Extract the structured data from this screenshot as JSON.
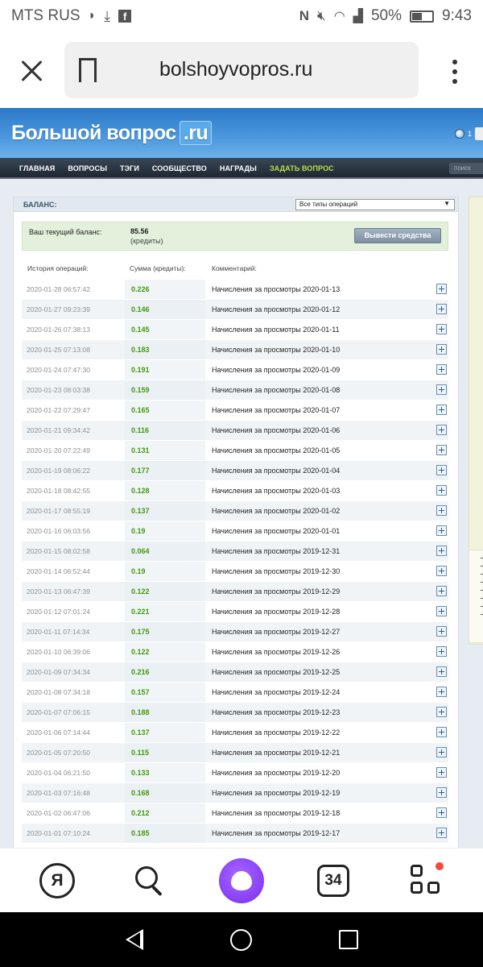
{
  "status_bar": {
    "carrier": "MTS RUS",
    "battery": "50%",
    "time": "9:43"
  },
  "browser": {
    "url": "bolshoyvopros.ru"
  },
  "site": {
    "logo_text": "Большой вопрос",
    "logo_domain": ".ru",
    "header_count": "1",
    "nav": [
      {
        "label": "ГЛАВНАЯ"
      },
      {
        "label": "ВОПРОСЫ"
      },
      {
        "label": "ТЭГИ"
      },
      {
        "label": "СООБЩЕСТВО"
      },
      {
        "label": "НАГРАДЫ"
      },
      {
        "label": "ЗАДАТЬ ВОПРОС"
      }
    ],
    "search_placeholder": "поиск"
  },
  "balance": {
    "section_title": "БАЛАНС:",
    "filter_selected": "Все типы операций",
    "current_label": "Ваш текущий баланс:",
    "amount": "85.56",
    "units": "(кредиты)",
    "withdraw_label": "Вывести средства"
  },
  "history": {
    "col_date": "История операций:",
    "col_sum": "Сумма (кредиты):",
    "col_comment": "Комментарий:",
    "rows": [
      {
        "date": "2020-01-28 06:57:42",
        "sum": "0.226",
        "comment": "Начисления за просмотры 2020-01-13"
      },
      {
        "date": "2020-01-27 09:23:39",
        "sum": "0.146",
        "comment": "Начисления за просмотры 2020-01-12"
      },
      {
        "date": "2020-01-26 07:38:13",
        "sum": "0.145",
        "comment": "Начисления за просмотры 2020-01-11"
      },
      {
        "date": "2020-01-25 07:13:08",
        "sum": "0.183",
        "comment": "Начисления за просмотры 2020-01-10"
      },
      {
        "date": "2020-01-24 07:47:30",
        "sum": "0.191",
        "comment": "Начисления за просмотры 2020-01-09"
      },
      {
        "date": "2020-01-23 08:03:38",
        "sum": "0.159",
        "comment": "Начисления за просмотры 2020-01-08"
      },
      {
        "date": "2020-01-22 07:29:47",
        "sum": "0.165",
        "comment": "Начисления за просмотры 2020-01-07"
      },
      {
        "date": "2020-01-21 09:34:42",
        "sum": "0.116",
        "comment": "Начисления за просмотры 2020-01-06"
      },
      {
        "date": "2020-01-20 07:22:49",
        "sum": "0.131",
        "comment": "Начисления за просмотры 2020-01-05"
      },
      {
        "date": "2020-01-19 08:06:22",
        "sum": "0.177",
        "comment": "Начисления за просмотры 2020-01-04"
      },
      {
        "date": "2020-01-18 08:42:55",
        "sum": "0.128",
        "comment": "Начисления за просмотры 2020-01-03"
      },
      {
        "date": "2020-01-17 08:55:19",
        "sum": "0.137",
        "comment": "Начисления за просмотры 2020-01-02"
      },
      {
        "date": "2020-01-16 06:03:56",
        "sum": "0.19",
        "comment": "Начисления за просмотры 2020-01-01"
      },
      {
        "date": "2020-01-15 08:02:58",
        "sum": "0.064",
        "comment": "Начисления за просмотры 2019-12-31"
      },
      {
        "date": "2020-01-14 06:52:44",
        "sum": "0.19",
        "comment": "Начисления за просмотры 2019-12-30"
      },
      {
        "date": "2020-01-13 06:47:39",
        "sum": "0.122",
        "comment": "Начисления за просмотры 2019-12-29"
      },
      {
        "date": "2020-01-12 07:01:24",
        "sum": "0.221",
        "comment": "Начисления за просмотры 2019-12-28"
      },
      {
        "date": "2020-01-11 07:14:34",
        "sum": "0.175",
        "comment": "Начисления за просмотры 2019-12-27"
      },
      {
        "date": "2020-01-10 06:39:06",
        "sum": "0.122",
        "comment": "Начисления за просмотры 2019-12-26"
      },
      {
        "date": "2020-01-09 07:34:34",
        "sum": "0.216",
        "comment": "Начисления за просмотры 2019-12-25"
      },
      {
        "date": "2020-01-08 07:34:18",
        "sum": "0.157",
        "comment": "Начисления за просмотры 2019-12-24"
      },
      {
        "date": "2020-01-07 07:06:15",
        "sum": "0.188",
        "comment": "Начисления за просмотры 2019-12-23"
      },
      {
        "date": "2020-01-06 07:14:44",
        "sum": "0.137",
        "comment": "Начисления за просмотры 2019-12-22"
      },
      {
        "date": "2020-01-05 07:20:50",
        "sum": "0.115",
        "comment": "Начисления за просмотры 2019-12-21"
      },
      {
        "date": "2020-01-04 06:21:50",
        "sum": "0.133",
        "comment": "Начисления за просмотры 2019-12-20"
      },
      {
        "date": "2020-01-03 07:16:48",
        "sum": "0.168",
        "comment": "Начисления за просмотры 2019-12-19"
      },
      {
        "date": "2020-01-02 06:47:06",
        "sum": "0.212",
        "comment": "Начисления за просмотры 2019-12-18"
      },
      {
        "date": "2020-01-01 07:10:24",
        "sum": "0.185",
        "comment": "Начисления за просмотры 2019-12-17"
      }
    ]
  },
  "bottom_bar": {
    "yandex_letter": "Я",
    "tab_count": "34"
  },
  "colors": {
    "header_blue": "#3a88d4",
    "nav_dark": "#1e2833",
    "ask_green": "#b5e04a",
    "sum_green": "#41980a",
    "alice_purple": "#7b2df0",
    "notification_red": "#f04a3c"
  }
}
